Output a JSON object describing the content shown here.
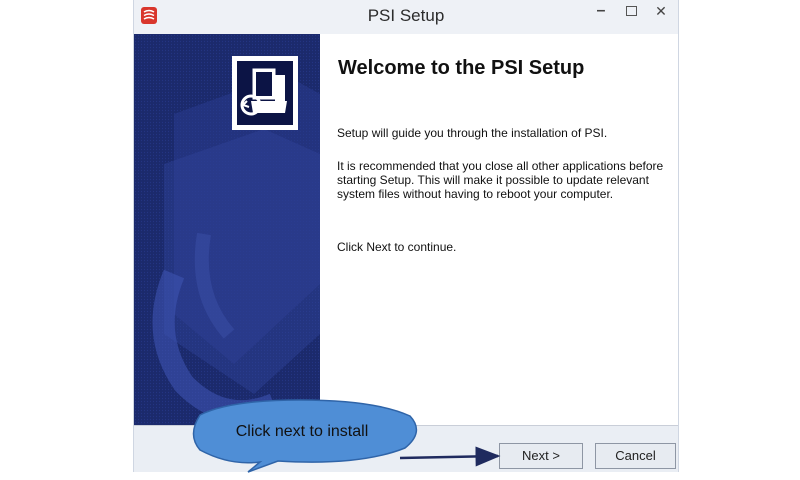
{
  "window": {
    "title": "PSI Setup",
    "minimize_glyph": "–",
    "close_glyph": "✕",
    "app_icon": "psi-app-icon",
    "accent_color": "#1d2b6e"
  },
  "content": {
    "heading": "Welcome to the PSI Setup",
    "para1": "Setup will guide you through the installation of PSI.",
    "para2": "It is recommended that you close all other applications before starting Setup. This will make it possible to update relevant system files without having to reboot your computer.",
    "para3": "Click Next to continue."
  },
  "buttons": {
    "next": "Next >",
    "cancel": "Cancel"
  },
  "annotation": {
    "callout": "Click next to install",
    "callout_color": "#4f8ed6"
  }
}
